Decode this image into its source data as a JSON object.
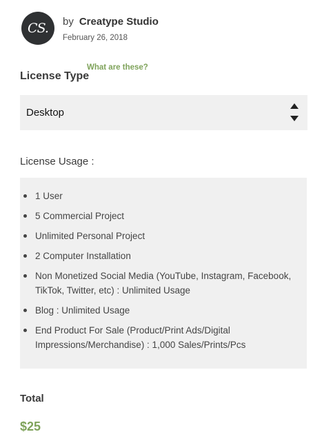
{
  "author": {
    "avatar_initials": "CS.",
    "by": "by",
    "name": "Creatype Studio",
    "date": "February 26, 2018"
  },
  "license_type": {
    "label": "License Type",
    "help_link": "What are these?",
    "selected": "Desktop"
  },
  "license_usage": {
    "label": "License Usage :",
    "items": [
      "1 User",
      "5 Commercial Project",
      "Unlimited Personal Project",
      "2 Computer Installation",
      "Non Monetized Social Media (YouTube, Instagram, Facebook, TikTok, Twitter, etc) : Unlimited Usage",
      "Blog : Unlimited Usage",
      "End Product For Sale (Product/Print Ads/Digital Impressions/Merchandise) : 1,000 Sales/Prints/Pcs"
    ]
  },
  "total": {
    "label": "Total",
    "price": "$25"
  },
  "colors": {
    "accent_green": "#7fa35b",
    "panel_gray": "#f0f0f0",
    "avatar_dark": "#2f3133"
  }
}
